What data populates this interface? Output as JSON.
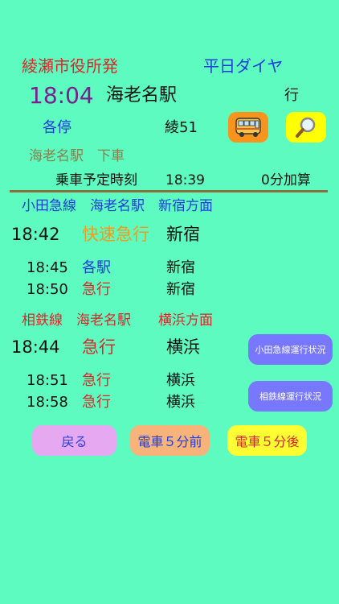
{
  "header": {
    "origin": "綾瀬市役所発",
    "day_type": "平日ダイヤ",
    "time": "18:04",
    "destination": "海老名駅",
    "bound": "行",
    "bus_type": "各停",
    "route": "綾51"
  },
  "alight": {
    "label": "海老名駅　下車",
    "board_label": "乗車予定時刻",
    "board_time": "18:39",
    "extra": "0分加算"
  },
  "odakyu": {
    "header": "小田急線　海老名駅　新宿方面",
    "main": {
      "time": "18:42",
      "type": "快速急行",
      "dest": "新宿"
    },
    "rows": [
      {
        "time": "18:45",
        "type": "各駅",
        "dest": "新宿"
      },
      {
        "time": "18:50",
        "type": "急行",
        "dest": "新宿"
      }
    ],
    "status_button": "小田急線運行状況"
  },
  "sotetsu": {
    "header": "相鉄線　海老名駅　　横浜方面",
    "main": {
      "time": "18:44",
      "type": "急行",
      "dest": "横浜"
    },
    "rows": [
      {
        "time": "18:51",
        "type": "急行",
        "dest": "横浜"
      },
      {
        "time": "18:58",
        "type": "急行",
        "dest": "横浜"
      }
    ],
    "status_button": "相鉄線運行状況"
  },
  "buttons": {
    "back": "戻る",
    "prev": "電車５分前",
    "next": "電車５分後"
  },
  "icons": {
    "bus": "bus-icon",
    "search": "magnifier-icon"
  },
  "colors": {
    "background": "#5dfbc0",
    "bus_button": "#f7941d",
    "search_button": "#ffff00",
    "status_button": "#7777ff",
    "back_button": "#e6a8f0",
    "prev_button": "#f7b37a",
    "next_button": "#ffff33"
  }
}
